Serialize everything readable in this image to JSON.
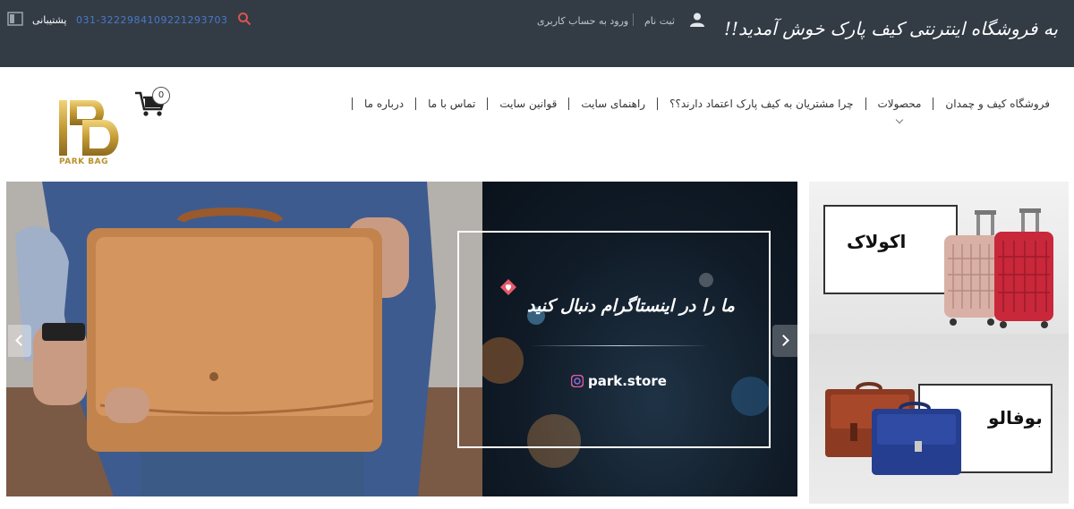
{
  "topbar": {
    "welcome": "به فروشگاه اینترنتی کیف پارک خوش آمدید!!",
    "register": "ثبت نام",
    "login": "ورود به حساب کاربری",
    "phone_mobile": "09221293703",
    "phone_landline": "031-32229841",
    "support": "پشتیبانی"
  },
  "nav": {
    "items": [
      {
        "label": "فروشگاه کیف و چمدان"
      },
      {
        "label": "محصولات"
      },
      {
        "label": "چرا مشتریان به کیف پارک اعتماد دارند؟؟"
      },
      {
        "label": "راهنمای سایت"
      },
      {
        "label": "قوانین سایت"
      },
      {
        "label": "تماس با ما"
      },
      {
        "label": "درباره ما"
      }
    ]
  },
  "cart": {
    "count": "0"
  },
  "logo": {
    "text": "PARK BAG"
  },
  "slider": {
    "headline": "ما را در اینستاگرام دنبال کنید",
    "handle": "park.store"
  },
  "banners": {
    "first": "اکولاک",
    "second": "بوفالو"
  },
  "colors": {
    "topbar": "#333c45",
    "phone": "#4a78c9",
    "gold": "#b8912b",
    "accent_red": "#d9534f"
  }
}
